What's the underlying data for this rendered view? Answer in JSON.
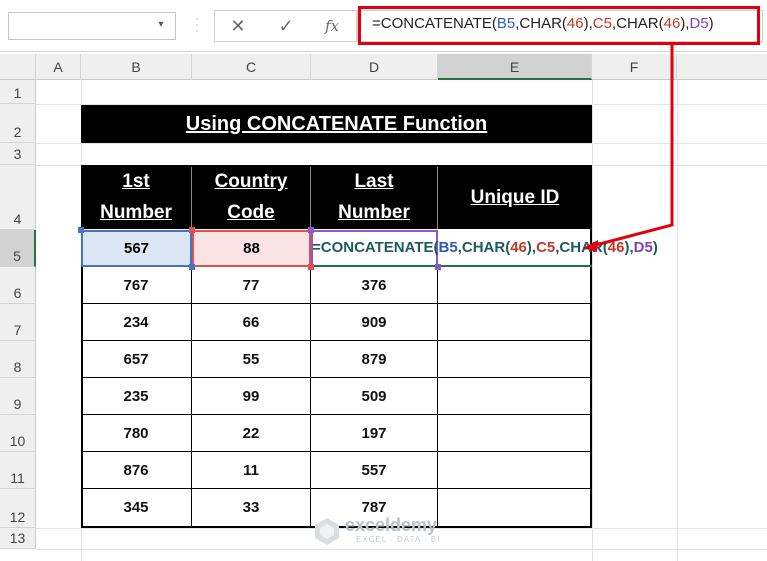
{
  "formula_bar": {
    "namebox_value": "",
    "cancel_icon": "✕",
    "enter_icon": "✓",
    "fx_label": "fx",
    "formula_parts": [
      "=CONCATENATE(",
      "B5",
      ",CHAR(",
      "46",
      "),",
      "C5",
      ",CHAR(",
      "46",
      "),",
      "D5",
      ")"
    ]
  },
  "columns": [
    "A",
    "B",
    "C",
    "D",
    "E",
    "F"
  ],
  "rows": [
    "1",
    "2",
    "3",
    "4",
    "5",
    "6",
    "7",
    "8",
    "9",
    "10",
    "11",
    "12",
    "13"
  ],
  "title": "Using CONCATENATE Function",
  "headers": {
    "col1_line1": "1st",
    "col1_line2": "Number",
    "col2_line1": "Country",
    "col2_line2": "Code",
    "col3_line1": "Last",
    "col3_line2": "Number",
    "col4": "Unique ID"
  },
  "table": [
    {
      "b": "567",
      "c": "88",
      "d": ""
    },
    {
      "b": "767",
      "c": "77",
      "d": "376"
    },
    {
      "b": "234",
      "c": "66",
      "d": "909"
    },
    {
      "b": "657",
      "c": "55",
      "d": "879"
    },
    {
      "b": "235",
      "c": "99",
      "d": "509"
    },
    {
      "b": "780",
      "c": "22",
      "d": "197"
    },
    {
      "b": "876",
      "c": "11",
      "d": "557"
    },
    {
      "b": "345",
      "c": "33",
      "d": "787"
    }
  ],
  "incell_formula_parts": [
    "=CONCATENATE(",
    "B5",
    ",CHAR(",
    "46",
    "),",
    "C5",
    ",CHAR(",
    "46",
    "),",
    "D5",
    ")"
  ],
  "watermark": {
    "name": "exceldemy",
    "tagline": "EXCEL · DATA · BI"
  },
  "colors": {
    "highlight_red": "#e00010",
    "ref_blue": "#4472c4",
    "ref_red": "#e05050",
    "ref_purple": "#8a5ac8",
    "active_green": "#217346"
  }
}
